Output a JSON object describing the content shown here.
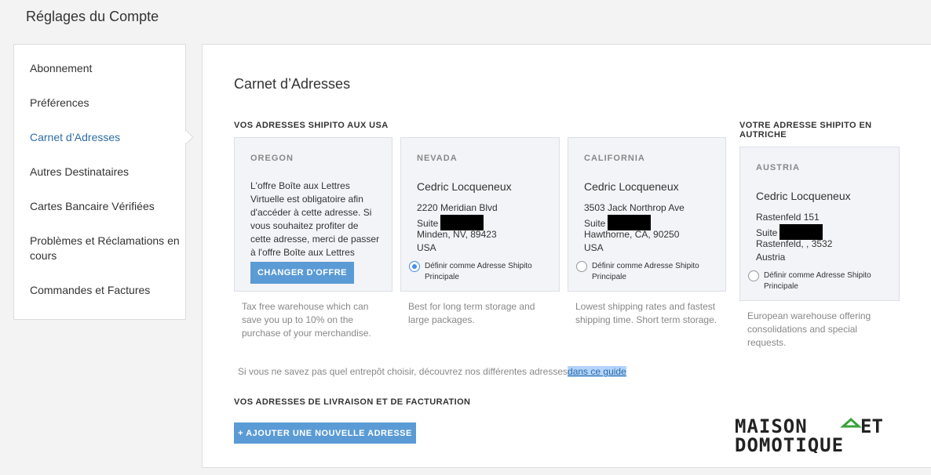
{
  "header": {
    "title": "Réglages du Compte"
  },
  "sidebar": {
    "items": [
      {
        "label": "Abonnement"
      },
      {
        "label": "Préférences"
      },
      {
        "label": "Carnet d’Adresses",
        "active": true
      },
      {
        "label": "Autres Destinataires"
      },
      {
        "label": "Cartes Bancaire Vérifiées"
      },
      {
        "label": "Problèmes et Réclamations en cours"
      },
      {
        "label": "Commandes et Factures"
      }
    ]
  },
  "main": {
    "title": "Carnet d’Adresses",
    "usa_heading": "VOS ADRESSES SHIPITO AUX USA",
    "austria_heading": "VOTRE ADRESSE SHIPITO EN AUTRICHE",
    "cards": {
      "oregon": {
        "region": "OREGON",
        "text": "L'offre Boîte aux Lettres Virtuelle est obligatoire afin d'accéder à cette adresse. Si vous souhaitez profiter de cette adresse, merci de passer à l'offre Boîte aux Lettres",
        "button": "CHANGER D'OFFRE",
        "desc": "Tax free warehouse which can save you up to 10% on the purchase of your merchandise."
      },
      "nevada": {
        "region": "NEVADA",
        "name": "Cedric Locqueneux",
        "line1": "2220 Meridian Blvd",
        "suite": "Suite",
        "city": "Minden, NV, 89423",
        "country": "USA",
        "radio_label": "Définir comme Adresse Shipito Principale",
        "checked": true,
        "desc": "Best for long term storage and large packages."
      },
      "california": {
        "region": "CALIFORNIA",
        "name": "Cedric Locqueneux",
        "line1": "3503 Jack Northrop Ave",
        "suite": "Suite",
        "city": "Hawthorne, CA, 90250",
        "country": "USA",
        "radio_label": "Définir comme Adresse Shipito Principale",
        "checked": false,
        "desc": "Lowest shipping rates and fastest shipping time. Short term storage."
      },
      "austria": {
        "region": "AUSTRIA",
        "name": "Cedric Locqueneux",
        "line1": "Rastenfeld 151",
        "suite": "Suite",
        "city": "Rastenfeld, , 3532",
        "country": "Austria",
        "radio_label": "Définir comme Adresse Shipito Principale",
        "checked": false,
        "desc": "European warehouse offering consolidations and special requests."
      }
    },
    "guide_text": "Si vous ne savez pas quel entrepôt choisir, découvrez nos différentes adresses",
    "guide_link": "dans ce guide",
    "delivery_heading": "VOS ADRESSES DE LIVRAISON ET DE FACTURATION",
    "add_button": "+ AJOUTER UNE NOUVELLE ADRESSE"
  },
  "logo": {
    "line1": "MAISON",
    "line1b": "ET",
    "line2": "DOMOTIQUE",
    "color": "#222222",
    "accent": "#3aa33a"
  }
}
